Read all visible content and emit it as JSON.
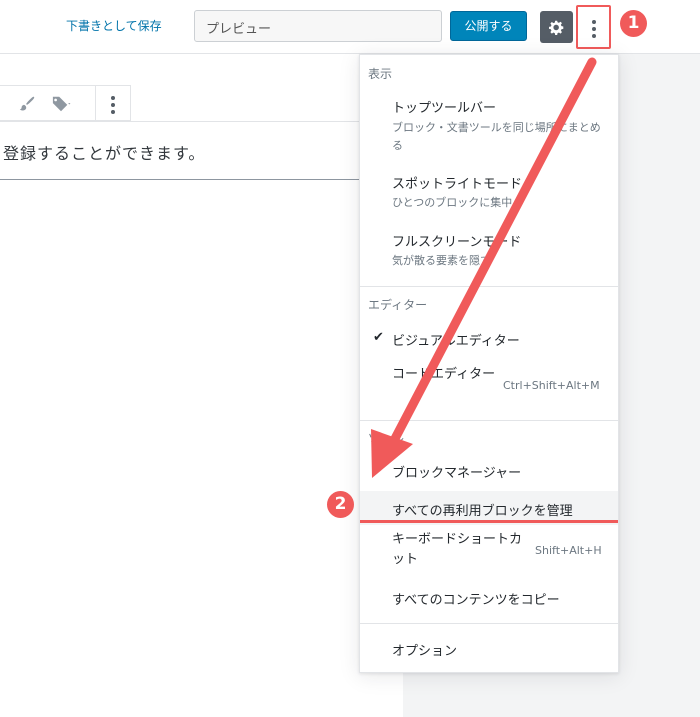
{
  "toolbar": {
    "save_draft_label": "下書きとして保存",
    "preview_label": "プレビュー",
    "publish_label": "公開する",
    "settings_icon": "gear-icon",
    "more_icon": "vertical-ellipsis-icon"
  },
  "editor": {
    "paragraph_text": "登録することができます。"
  },
  "menu": {
    "view": {
      "label": "表示",
      "items": [
        {
          "label": "トップツールバー",
          "description": "ブロック・文書ツールを同じ場所にまとめる"
        },
        {
          "label": "スポットライトモード",
          "description": "ひとつのブロックに集中"
        },
        {
          "label": "フルスクリーンモード",
          "description": "気が散る要素を隠す"
        }
      ]
    },
    "editor": {
      "label": "エディター",
      "items": [
        {
          "label": "ビジュアルエディター",
          "checked": true
        },
        {
          "label": "コードエディター",
          "shortcut": "Ctrl+Shift+Alt+M"
        }
      ]
    },
    "tools": {
      "label": "ツール",
      "items": [
        {
          "label": "ブロックマネージャー"
        },
        {
          "label": "すべての再利用ブロックを管理",
          "highlighted": true
        },
        {
          "label": "キーボードショートカット",
          "shortcut": "Shift+Alt+H"
        },
        {
          "label": "すべてのコンテンツをコピー"
        }
      ]
    },
    "options_label": "オプション"
  },
  "annotations": {
    "step1": "1",
    "step2": "2",
    "accent": "#f05a5a"
  }
}
